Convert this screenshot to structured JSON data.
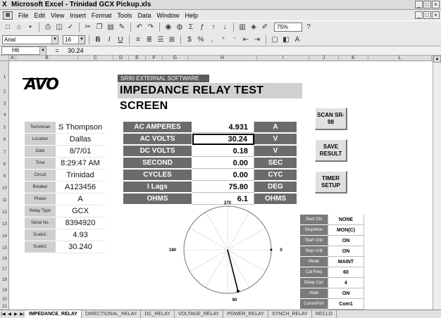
{
  "window": {
    "title": "Microsoft Excel - Trinidad GCX Pickup.xls",
    "icon_name": "excel-icon",
    "controls": [
      "_",
      "□",
      "×"
    ]
  },
  "menubar": {
    "items": [
      "File",
      "Edit",
      "View",
      "Insert",
      "Format",
      "Tools",
      "Data",
      "Window",
      "Help"
    ]
  },
  "toolbar": {
    "zoom": "75%"
  },
  "format_toolbar": {
    "font": "Arial",
    "size": "16",
    "bold": "B",
    "italic": "I",
    "underline": "U"
  },
  "formula_bar": {
    "cell": "H6",
    "equals": "=",
    "value": "30.24"
  },
  "columns": [
    "A",
    "B",
    "C",
    "D",
    "E",
    "F",
    "G",
    "H",
    "I",
    "J",
    "K",
    "L"
  ],
  "rows": [
    "1",
    "2",
    "3",
    "4",
    "5",
    "6",
    "7",
    "8",
    "9",
    "10",
    "11",
    "12",
    "13",
    "14",
    "15",
    "16",
    "17",
    "18",
    "19",
    "20",
    "21"
  ],
  "header": {
    "logo": "AVO",
    "software_label": "SR90 EXTERNAL SOFTWARE",
    "title": "IMPEDANCE RELAY TEST SCREEN"
  },
  "info": [
    {
      "label": "Technician",
      "value": "S Thompson"
    },
    {
      "label": "Location",
      "value": "Dallas"
    },
    {
      "label": "Date",
      "value": "8/7/01"
    },
    {
      "label": "Time",
      "value": "8:29:47 AM"
    },
    {
      "label": "Circuit",
      "value": "Trinidad"
    },
    {
      "label": "Breaker",
      "value": "A123456"
    },
    {
      "label": "Phase",
      "value": "A"
    },
    {
      "label": "Relay Type",
      "value": "GCX"
    },
    {
      "label": "Serial No.",
      "value": "8394920"
    },
    {
      "label": "Scale1:",
      "value": "4.93"
    },
    {
      "label": "Scale2:",
      "value": "30.240"
    }
  ],
  "measurements": [
    {
      "label": "AC AMPERES",
      "value": "4.931",
      "unit": "A"
    },
    {
      "label": "AC VOLTS",
      "value": "30.24",
      "unit": "V"
    },
    {
      "label": "DC VOLTS",
      "value": "0.18",
      "unit": "V"
    },
    {
      "label": "SECOND",
      "value": "0.00",
      "unit": "SEC"
    },
    {
      "label": "CYCLES",
      "value": "0.00",
      "unit": "CYC"
    },
    {
      "label": "I Lags",
      "value": "75.80",
      "unit": "DEG"
    },
    {
      "label": "OHMS",
      "value": "6.1",
      "unit": "OHMS"
    }
  ],
  "buttons": {
    "scan": "SCAN SR-98",
    "save": "SAVE RESULT",
    "timer": "TIMER SETUP"
  },
  "polar": {
    "top": "270",
    "left": "180",
    "right": "0",
    "bottom": "90",
    "vector_angle_deg": 75.8
  },
  "status": [
    {
      "label": "Start Ckt",
      "value": "NONE"
    },
    {
      "label": "Stop/Mon",
      "value": "MON(C)"
    },
    {
      "label": "Start Unit",
      "value": "ON"
    },
    {
      "label": "Stop Unit",
      "value": "ON"
    },
    {
      "label": "Mode",
      "value": "MAINT"
    },
    {
      "label": "Cal Freq",
      "value": "60"
    },
    {
      "label": "Delay Cyc",
      "value": "4"
    },
    {
      "label": "Hold",
      "value": "ON"
    },
    {
      "label": "CommPort",
      "value": "Com1"
    }
  ],
  "sheet_tabs": [
    "IMPEDANCE_RELAY",
    "DIRECTIONAL_RELAY",
    "DC_RELAY",
    "VOLTAGE_RELAY",
    "POWER_RELAY",
    "SYNCH_RELAY",
    "RECLO"
  ]
}
